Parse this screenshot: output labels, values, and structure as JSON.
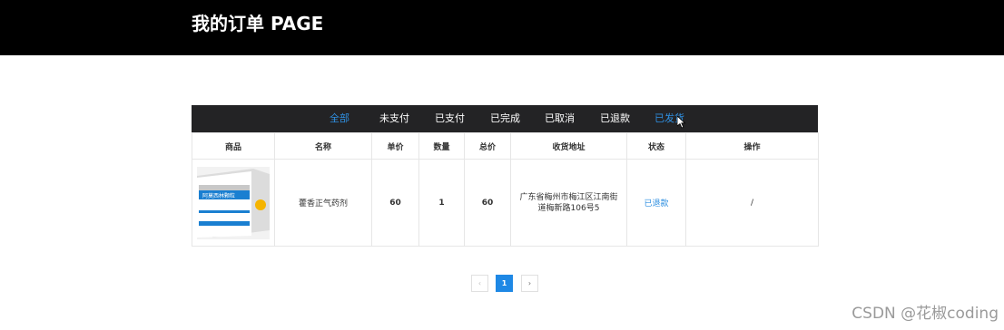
{
  "header": {
    "title": "我的订单 PAGE"
  },
  "colors": {
    "accent": "#2f8fe0",
    "header_bg": "#000000",
    "tabbar_bg": "#232325",
    "page_active": "#1e88e5"
  },
  "tabs": [
    {
      "label": "全部",
      "active": true
    },
    {
      "label": "未支付",
      "active": false
    },
    {
      "label": "已支付",
      "active": false
    },
    {
      "label": "已完成",
      "active": false
    },
    {
      "label": "已取消",
      "active": false
    },
    {
      "label": "已退款",
      "active": false
    },
    {
      "label": "已发货",
      "active": false,
      "hovered": true
    }
  ],
  "table": {
    "headers": [
      "商品",
      "名称",
      "单价",
      "数量",
      "总价",
      "收货地址",
      "状态",
      "操作"
    ],
    "rows": [
      {
        "image_alt": "阿莫西林颗粒",
        "image_text": "阿莫西林颗粒",
        "name": "藿香正气药剂",
        "price": "60",
        "quantity": "1",
        "total": "60",
        "address": "广东省梅州市梅江区江南街道梅新路106号5",
        "status": "已退款",
        "action": "/"
      }
    ]
  },
  "pagination": {
    "prev": "‹",
    "current": "1",
    "next": "›"
  },
  "watermark": "CSDN @花椒coding"
}
